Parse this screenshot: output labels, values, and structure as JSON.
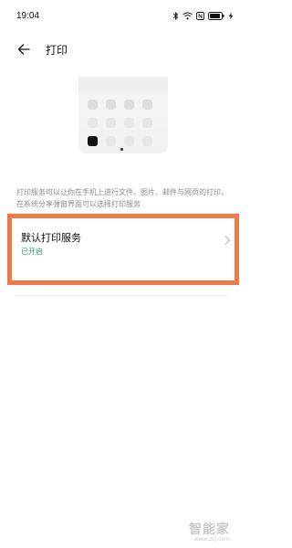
{
  "status_bar": {
    "time": "19:04",
    "icons": [
      "bluetooth-icon",
      "wifi-icon",
      "nfc-icon",
      "battery-icon",
      "charging-icon"
    ]
  },
  "header": {
    "back_icon": "back-arrow-icon",
    "title": "打印"
  },
  "illustration": {
    "description_icon": "phone-share-grid-icon"
  },
  "description": "打印服务可以让你在手机上进行文件、图片、邮件与网页的打印，在系统分享弹窗界面可以选择打印服务",
  "print_service": {
    "title": "默认打印服务",
    "status": "已开启",
    "chevron_icon": "chevron-right-icon",
    "highlight_color": "#f07a45",
    "status_color": "#2aa36a"
  },
  "watermark": {
    "brand": "智能家",
    "url": "www.znj.com"
  }
}
